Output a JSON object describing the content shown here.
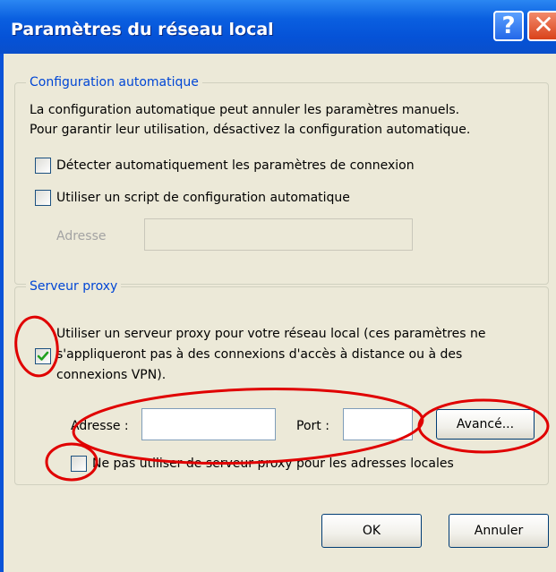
{
  "window": {
    "title": "Paramètres du réseau local",
    "help_glyph": "?",
    "close_glyph": "✕"
  },
  "auto_config": {
    "title": "Configuration automatique",
    "description_line1": "La configuration automatique peut annuler les paramètres manuels.",
    "description_line2": "Pour garantir leur utilisation, désactivez la configuration automatique.",
    "detect_label": "Détecter automatiquement les paramètres de connexion",
    "detect_checked": false,
    "script_label": "Utiliser un script de configuration automatique",
    "script_checked": false,
    "address_label": "Adresse",
    "address_value": ""
  },
  "proxy": {
    "title": "Serveur proxy",
    "use_proxy_line1": "Utiliser un serveur proxy pour votre réseau local (ces paramètres ne",
    "use_proxy_line2": "s'appliqueront pas à des connexions d'accès à distance ou à des",
    "use_proxy_line3": "connexions VPN).",
    "use_proxy_checked": true,
    "address_label": "Adresse :",
    "address_value": "",
    "port_label": "Port :",
    "port_value": "",
    "advanced_label": "Avancé...",
    "bypass_local_label": "Ne pas utiliser de serveur proxy pour les adresses locales",
    "bypass_local_checked": false
  },
  "footer": {
    "ok_label": "OK",
    "cancel_label": "Annuler"
  },
  "colors": {
    "titlebar": "#0552d7",
    "group_title": "#0046d5",
    "annotation_red": "#e00000",
    "check_green": "#21a121"
  }
}
